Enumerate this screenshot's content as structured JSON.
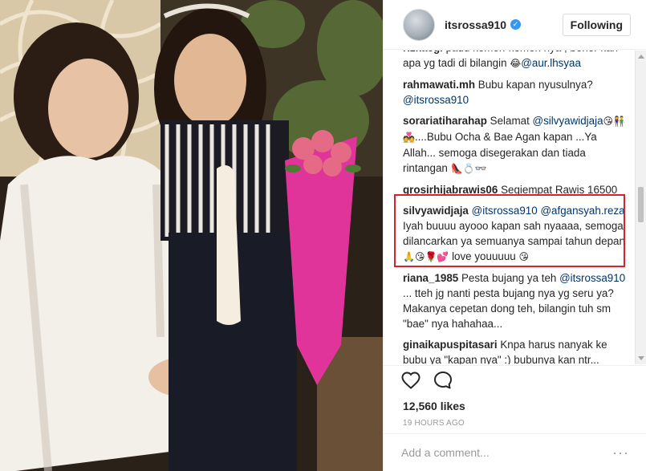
{
  "post": {
    "username": "itsrossa910",
    "verified_icon": "verified-badge-icon",
    "follow_label": "Following",
    "likes": "12,560 likes",
    "time": "19 HOURS AGO",
    "comment_placeholder": "Add a comment...",
    "more_label": "···"
  },
  "comments": [
    {
      "user": "rizkaegi",
      "parts": [
        {
          "t": "padu komen-komen nya , bener kan apa yg tadi di bilangin "
        },
        {
          "e": "😂"
        },
        {
          "m": "@aur.lhsyaa"
        }
      ]
    },
    {
      "user": "rahmawati.mh",
      "parts": [
        {
          "t": "Bubu kapan nyusulnya? "
        },
        {
          "m": "@itsrossa910"
        }
      ]
    },
    {
      "user": "sorariatiharahap",
      "parts": [
        {
          "t": "Selamat "
        },
        {
          "m": "@silvyawidjaja"
        },
        {
          "e": "😘"
        },
        {
          "e": "👫💑"
        },
        {
          "t": "....Bubu Ocha & Bae Agan kapan ...Ya Allah... semoga disegerakan dan tiada rintangan "
        },
        {
          "e": "👠💍👓"
        }
      ]
    },
    {
      "user": "grosirhijabrawis06",
      "parts": [
        {
          "t": "Segiempat Rawis 16500"
        }
      ]
    },
    {
      "user": "silvyawidjaja",
      "parts": [
        {
          "m": "@itsrossa910"
        },
        {
          "t": " "
        },
        {
          "m": "@afgansyah.reza"
        },
        {
          "t": " Iyah buuuu ayooo kapan sah nyaaaa, semoga dilancarkan ya semuanya sampai tahun depan "
        },
        {
          "e": "🙏😘🌹💕"
        },
        {
          "t": " love youuuuu "
        },
        {
          "e": "😘"
        }
      ]
    },
    {
      "user": "riana_1985",
      "parts": [
        {
          "t": "Pesta bujang ya teh "
        },
        {
          "m": "@itsrossa910"
        },
        {
          "t": " ... tteh jg nanti pesta bujang nya yg seru ya? Makanya cepetan dong teh, bilangin tuh sm \"bae\" nya hahahaa..."
        }
      ]
    },
    {
      "user": "ginaikapuspitasari",
      "parts": [
        {
          "t": "Knpa harus nanyak ke bubu ya \"kapan nya\" :) bubunya kan ntr..."
        }
      ]
    }
  ],
  "icons": {
    "like": "heart-icon",
    "comment": "comment-bubble-icon",
    "more": "more-options-icon"
  },
  "colors": {
    "highlight": "#d6222a",
    "mention": "#003569",
    "verified": "#3897f0"
  }
}
